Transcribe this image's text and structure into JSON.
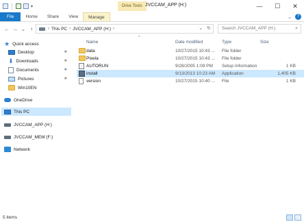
{
  "titlebar": {
    "context_tab": "Drive Tools",
    "window_title": "JVCCAM_APP (H:)",
    "minimize": "—",
    "maximize": "☐",
    "close": "✕"
  },
  "ribbon": {
    "tabs": [
      {
        "label": "File"
      },
      {
        "label": "Home"
      },
      {
        "label": "Share"
      },
      {
        "label": "View"
      },
      {
        "label": "Manage"
      }
    ],
    "expand_glyph": "⌄",
    "help_glyph": "?"
  },
  "navigation": {
    "back": "←",
    "forward": "→",
    "recent": "⌄",
    "up": "↑",
    "breadcrumb": [
      "This PC",
      "JVCCAM_APP (H:)"
    ],
    "crumb_sep": "›",
    "dropdown_glyph": "⌄",
    "refresh_glyph": "↻",
    "search_placeholder": "Search JVCCAM_APP (H:)",
    "search_glyph": "⌕"
  },
  "nav_pane": {
    "quick_access": "Quick access",
    "items": [
      {
        "label": "Desktop",
        "pinned": true
      },
      {
        "label": "Downloads",
        "pinned": true
      },
      {
        "label": "Documents",
        "pinned": true
      },
      {
        "label": "Pictures",
        "pinned": true
      },
      {
        "label": "Win10EN",
        "pinned": false
      }
    ],
    "onedrive": "OneDrive",
    "this_pc": "This PC",
    "drives": [
      {
        "label": "JVCCAM_APP (H:)"
      },
      {
        "label": "JVCCAM_MEM (F:)"
      }
    ],
    "network": "Network",
    "pin_glyph": "✱"
  },
  "file_list": {
    "columns": {
      "name": "Name",
      "date": "Date modified",
      "type": "Type",
      "size": "Size"
    },
    "sort_glyph": "^",
    "rows": [
      {
        "name": "data",
        "date": "10/27/2015 10:43 ...",
        "type": "File folder",
        "size": "",
        "icon": "folder-icon"
      },
      {
        "name": "Pixela",
        "date": "10/27/2015 10:43 ...",
        "type": "File folder",
        "size": "",
        "icon": "folder-icon"
      },
      {
        "name": "AUTORUN",
        "date": "9/28/2005 1:09 PM",
        "type": "Setup Information",
        "size": "1 KB",
        "icon": "autorun-icon"
      },
      {
        "name": "install",
        "date": "9/13/2013 10:23 AM",
        "type": "Application",
        "size": "1,405 KB",
        "icon": "installer-icon",
        "selected": true
      },
      {
        "name": "version",
        "date": "10/27/2015 10:40 ...",
        "type": "File",
        "size": "1 KB",
        "icon": "file-icon"
      }
    ]
  },
  "status": {
    "items_count": "5 items"
  },
  "colors": {
    "accent": "#1979ca",
    "selection": "#cce8ff",
    "folder": "#f1c75a"
  }
}
